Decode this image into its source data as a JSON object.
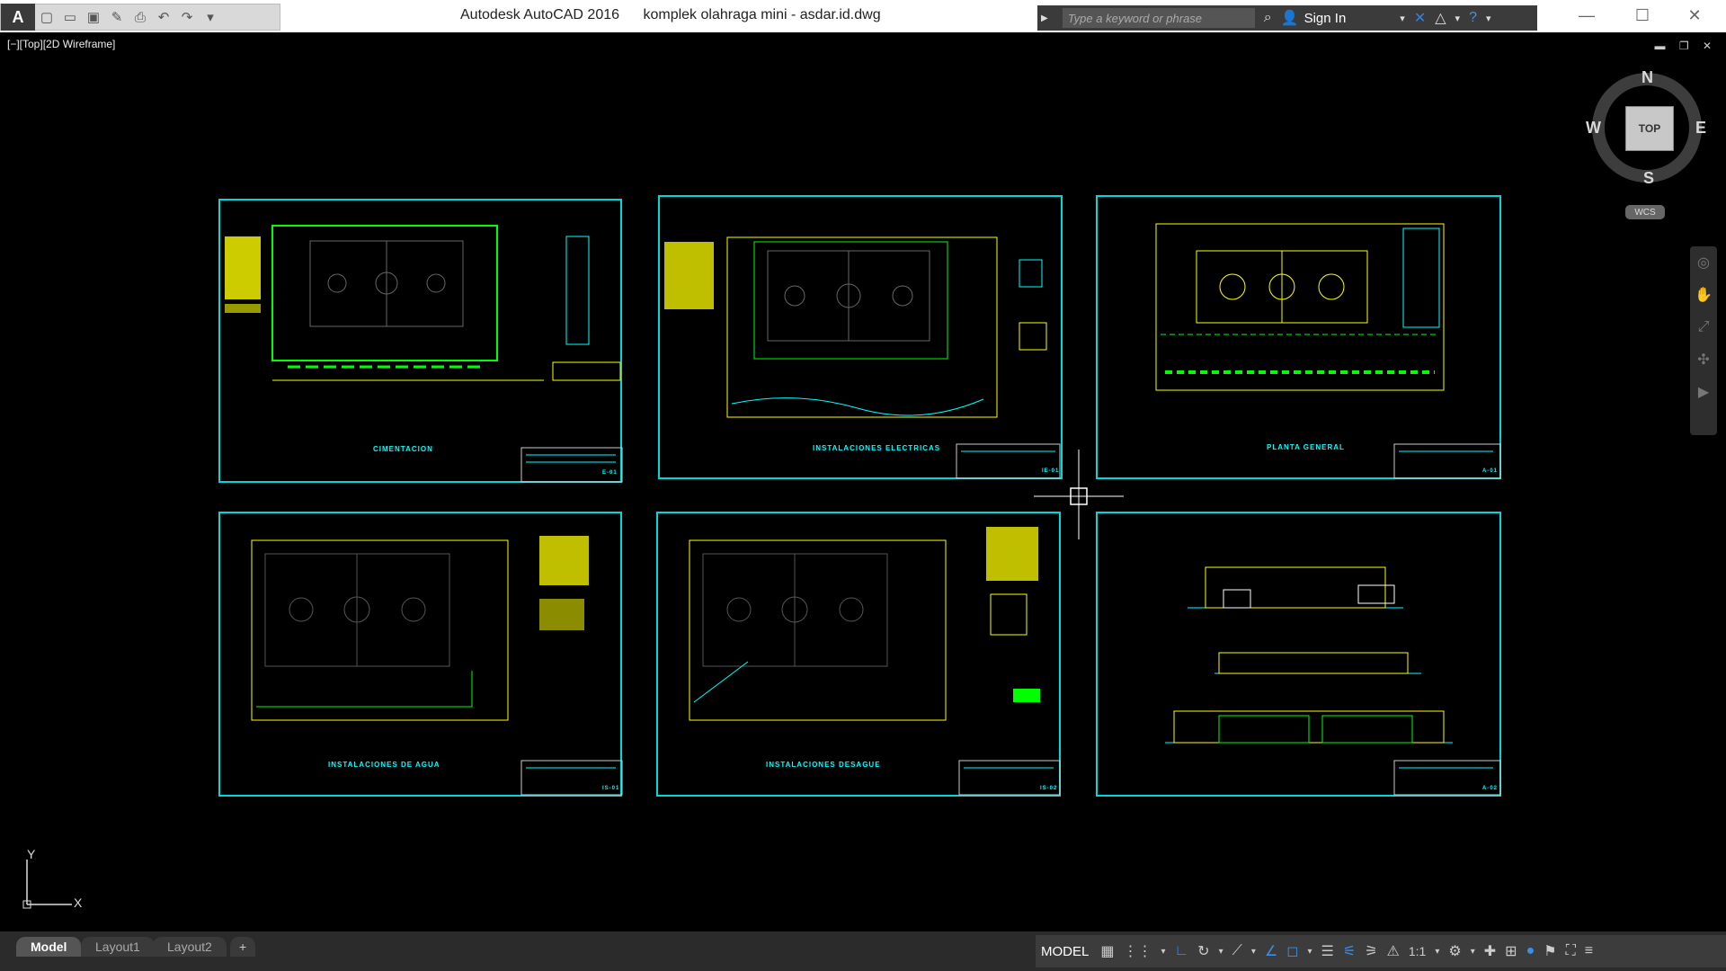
{
  "app": {
    "name": "Autodesk AutoCAD 2016",
    "file": "komplek olahraga mini - asdar.id.dwg"
  },
  "quick_access": {
    "icons": [
      "new-icon",
      "open-icon",
      "save-icon",
      "saveas-icon",
      "plot-icon",
      "undo-icon",
      "redo-icon",
      "customize-icon"
    ]
  },
  "infocenter": {
    "search_placeholder": "Type a keyword or phrase",
    "sign_in": "Sign In"
  },
  "viewport": {
    "label": "[−][Top][2D Wireframe]"
  },
  "viewcube": {
    "north": "N",
    "south": "S",
    "east": "E",
    "west": "W",
    "face": "TOP",
    "wcs": "WCS"
  },
  "ucs": {
    "x": "X",
    "y": "Y"
  },
  "sheets": [
    {
      "title": "CIMENTACION",
      "code": "E-01"
    },
    {
      "title": "INSTALACIONES ELECTRICAS",
      "code": "IE-01"
    },
    {
      "title": "PLANTA GENERAL",
      "code": "A-01"
    },
    {
      "title": "INSTALACIONES DE AGUA",
      "code": "IS-01"
    },
    {
      "title": "INSTALACIONES DESAGUE",
      "code": "IS-02"
    },
    {
      "title": "",
      "code": "A-02"
    }
  ],
  "layout_tabs": [
    "Model",
    "Layout1",
    "Layout2"
  ],
  "add_tab": "+",
  "status": {
    "model": "MODEL",
    "scale": "1:1"
  },
  "colors": {
    "sheet_border": "#00d7d7",
    "line_yellow": "#ffff00",
    "line_green": "#00ff00",
    "line_cyan": "#00ffff"
  }
}
